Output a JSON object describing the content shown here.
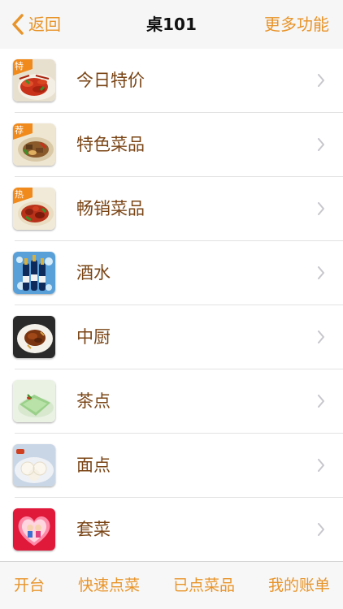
{
  "nav": {
    "back_label": "返回",
    "title": "桌101",
    "more_label": "更多功能"
  },
  "categories": [
    {
      "label": "今日特价",
      "badge": "特",
      "image": "crayfish-dish-thumbnail"
    },
    {
      "label": "特色菜品",
      "badge": "荐",
      "image": "stir-fry-dish-thumbnail"
    },
    {
      "label": "畅销菜品",
      "badge": "热",
      "image": "spicy-chicken-dish-thumbnail"
    },
    {
      "label": "酒水",
      "badge": "",
      "image": "beer-bottles-thumbnail"
    },
    {
      "label": "中厨",
      "badge": "",
      "image": "braised-dish-thumbnail"
    },
    {
      "label": "茶点",
      "badge": "",
      "image": "green-dessert-thumbnail"
    },
    {
      "label": "面点",
      "badge": "",
      "image": "steamed-buns-thumbnail"
    },
    {
      "label": "套菜",
      "badge": "",
      "image": "heart-couple-thumbnail"
    }
  ],
  "tabs": [
    {
      "label": "开台"
    },
    {
      "label": "快速点菜"
    },
    {
      "label": "已点菜品"
    },
    {
      "label": "我的账单"
    }
  ],
  "colors": {
    "accent": "#e8942a",
    "label_brown": "#7a4516",
    "badge_orange": "#f08a1c"
  },
  "icons": {
    "back": "chevron-left-icon",
    "row_disclosure": "chevron-right-icon"
  }
}
